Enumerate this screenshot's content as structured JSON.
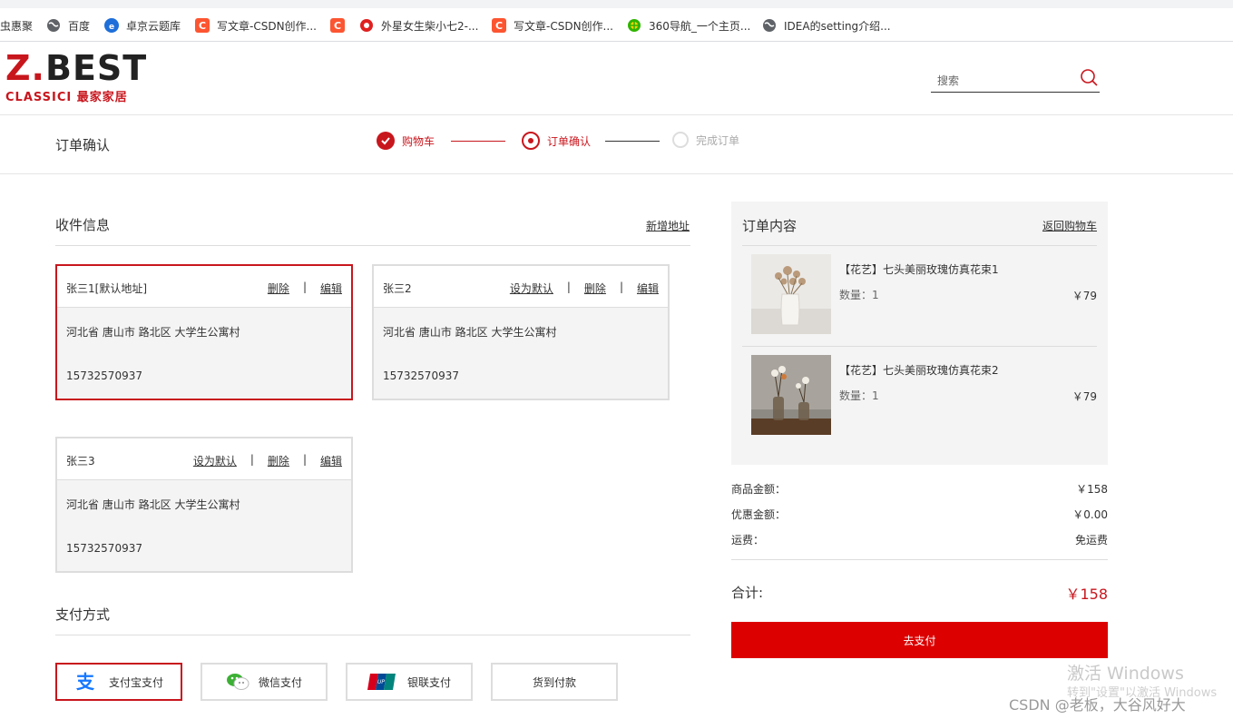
{
  "bookmarks": [
    {
      "label": "虫惠聚",
      "icon": "none"
    },
    {
      "label": "百度",
      "icon": "globe-icon"
    },
    {
      "label": "卓京云题库",
      "icon": "zhuojing-icon"
    },
    {
      "label": "写文章-CSDN创作...",
      "icon": "csdn-icon"
    },
    {
      "label": "",
      "icon": "csdn-icon"
    },
    {
      "label": "外星女生柴小七2-...",
      "icon": "waixing-icon"
    },
    {
      "label": "写文章-CSDN创作...",
      "icon": "csdn-icon"
    },
    {
      "label": "360导航_一个主页...",
      "icon": "360-icon"
    },
    {
      "label": "IDEA的setting介绍...",
      "icon": "globe-icon"
    }
  ],
  "header": {
    "logo_main_red": "Z.",
    "logo_main_dark": "BEST",
    "logo_sub": "CLASSICI 最家家居",
    "search_placeholder": "搜索"
  },
  "steps": {
    "page_title": "订单确认",
    "items": [
      {
        "label": "购物车",
        "state": "done"
      },
      {
        "label": "订单确认",
        "state": "current"
      },
      {
        "label": "完成订单",
        "state": "pending"
      }
    ]
  },
  "address_section": {
    "title": "收件信息",
    "add_link": "新增地址",
    "cards": [
      {
        "name": "张三1[默认地址]",
        "actions": [
          "删除",
          "编辑"
        ],
        "address": "河北省 唐山市 路北区 大学生公寓村",
        "phone": "15732570937",
        "selected": true
      },
      {
        "name": "张三2",
        "actions": [
          "设为默认",
          "删除",
          "编辑"
        ],
        "address": "河北省 唐山市 路北区 大学生公寓村",
        "phone": "15732570937",
        "selected": false
      },
      {
        "name": "张三3",
        "actions": [
          "设为默认",
          "删除",
          "编辑"
        ],
        "address": "河北省 唐山市 路北区 大学生公寓村",
        "phone": "15732570937",
        "selected": false
      }
    ]
  },
  "payment_section": {
    "title": "支付方式",
    "methods": [
      {
        "label": "支付宝支付",
        "icon": "alipay-icon",
        "selected": true
      },
      {
        "label": "微信支付",
        "icon": "wechat-icon",
        "selected": false
      },
      {
        "label": "银联支付",
        "icon": "unionpay-icon",
        "selected": false
      },
      {
        "label": "货到付款",
        "icon": "none",
        "selected": false
      }
    ]
  },
  "order": {
    "title": "订单内容",
    "back_link": "返回购物车",
    "items": [
      {
        "name": "【花艺】七头美丽玫瑰仿真花束1",
        "qty": "数量：1",
        "price": "￥79"
      },
      {
        "name": "【花艺】七头美丽玫瑰仿真花束2",
        "qty": "数量：1",
        "price": "￥79"
      }
    ],
    "summary": [
      {
        "label": "商品金额：",
        "value": "￥158"
      },
      {
        "label": "优惠金额：",
        "value": "￥0.00"
      },
      {
        "label": "运费：",
        "value": "免运费"
      }
    ],
    "total_label": "合计:",
    "total_value": "￥158",
    "pay_button": "去支付"
  },
  "overlay": {
    "activate_title": "激活 Windows",
    "activate_sub": "转到\"设置\"以激活 Windows",
    "csdn_watermark": "CSDN @老板，大谷风好大"
  },
  "colors": {
    "brand_red": "#c8161d",
    "pay_button": "#dc0000",
    "panel_bg": "#f4f4f4"
  }
}
